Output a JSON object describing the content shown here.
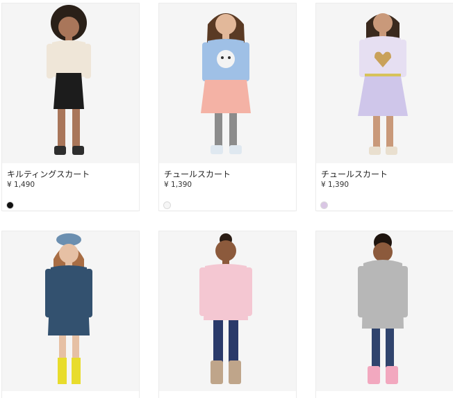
{
  "products": [
    {
      "name": "キルティングスカート",
      "price": "¥ 1,490",
      "swatch_color": "#111111"
    },
    {
      "name": "チュールスカート",
      "price": "¥ 1,390",
      "swatch_color": "#f6f6f6"
    },
    {
      "name": "チュールスカート",
      "price": "¥ 1,390",
      "swatch_color": "#d9c6e4"
    },
    {
      "name": "",
      "price": "",
      "swatch_color": ""
    },
    {
      "name": "",
      "price": "",
      "swatch_color": ""
    },
    {
      "name": "",
      "price": "",
      "swatch_color": ""
    }
  ]
}
